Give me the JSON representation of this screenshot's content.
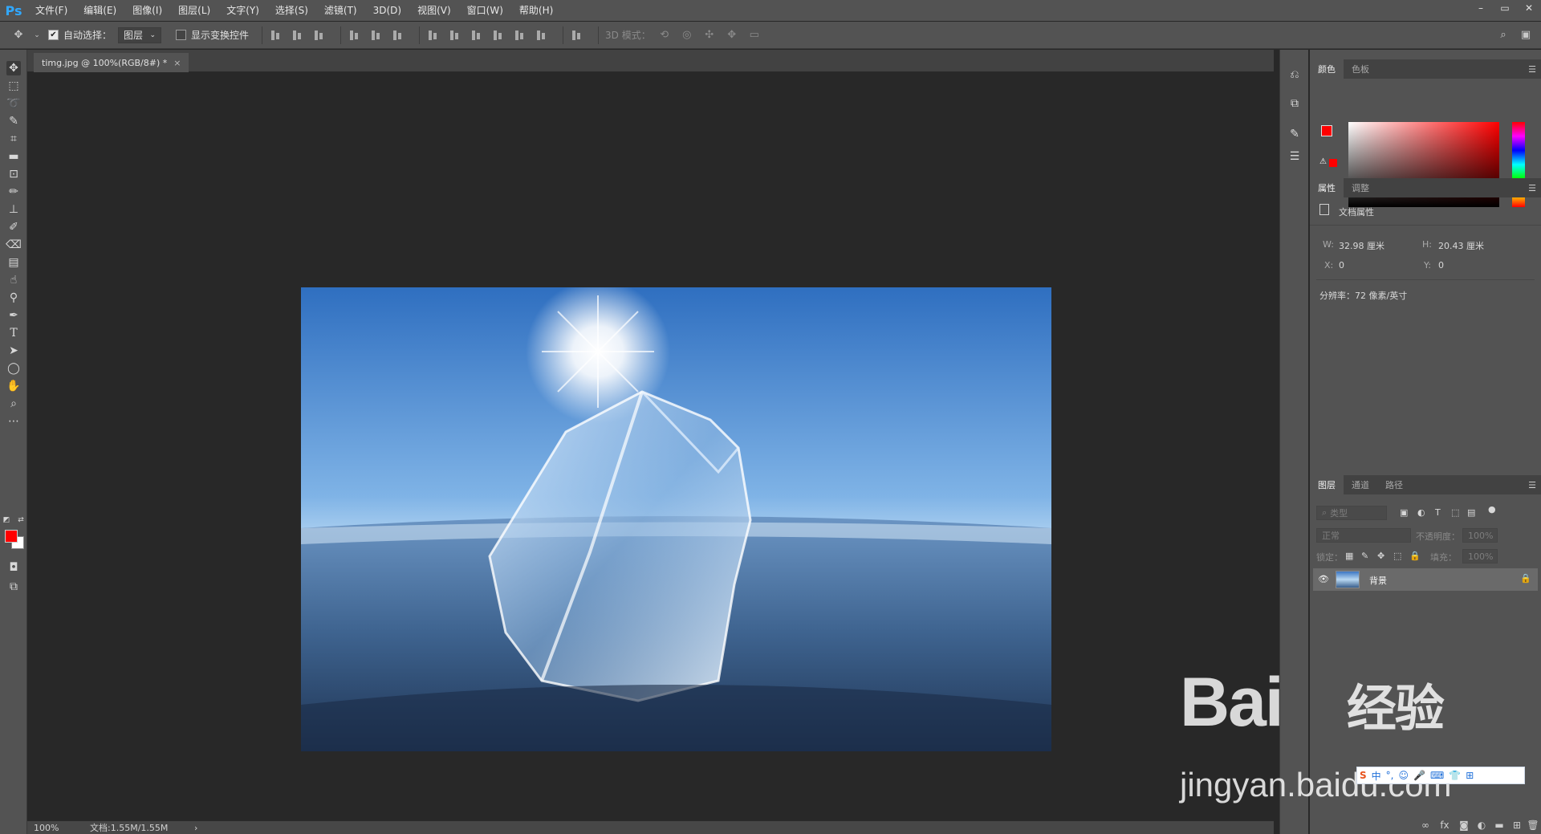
{
  "app": {
    "logo": "Ps"
  },
  "menubar": {
    "items": [
      "文件(F)",
      "编辑(E)",
      "图像(I)",
      "图层(L)",
      "文字(Y)",
      "选择(S)",
      "滤镜(T)",
      "3D(D)",
      "视图(V)",
      "窗口(W)",
      "帮助(H)"
    ]
  },
  "window_controls": {
    "minimize": "–",
    "restore": "▭",
    "close": "✕"
  },
  "options": {
    "auto_select_label": "自动选择：",
    "auto_select_checked": true,
    "layer_select_value": "图层",
    "show_transform_label": "显示变换控件",
    "show_transform_checked": false,
    "mode_3d_label": "3D 模式："
  },
  "document": {
    "tab_title": "timg.jpg @ 100%(RGB/8#) *",
    "close_glyph": "×"
  },
  "status": {
    "zoom": "100%",
    "doc_size": "文档:1.55M/1.55M",
    "arrow": "›"
  },
  "colors": {
    "foreground": "#ff0000",
    "background": "#ffffff",
    "ps_blue": "#31a8ff"
  },
  "color_panel": {
    "tabs": [
      "颜色",
      "色板"
    ],
    "active_tab": "颜色"
  },
  "properties_panel": {
    "tabs": [
      "属性",
      "调整"
    ],
    "active_tab": "属性",
    "section_title": "文档属性",
    "w_label": "W:",
    "w_value": "32.98 厘米",
    "h_label": "H:",
    "h_value": "20.43 厘米",
    "x_label": "X:",
    "x_value": "0",
    "y_label": "Y:",
    "y_value": "0",
    "resolution": "分辨率：72 像素/英寸"
  },
  "layers_panel": {
    "tabs": [
      "图层",
      "通道",
      "路径"
    ],
    "active_tab": "图层",
    "filter_placeholder": "类型",
    "blend_mode": "正常",
    "opacity_label": "不透明度：",
    "opacity_value": "100%",
    "lock_label": "锁定：",
    "fill_label": "填充：",
    "fill_value": "100%",
    "layers": [
      {
        "name": "背景",
        "visible": true,
        "locked": true
      }
    ]
  },
  "watermark": {
    "brand": "Bai",
    "brand_suffix": "经验",
    "url": "jingyan.baidu.com",
    "ime_chars": [
      "S",
      "中",
      "°,",
      "☺",
      "🎤",
      "⌨",
      "👕",
      "⊞"
    ]
  }
}
